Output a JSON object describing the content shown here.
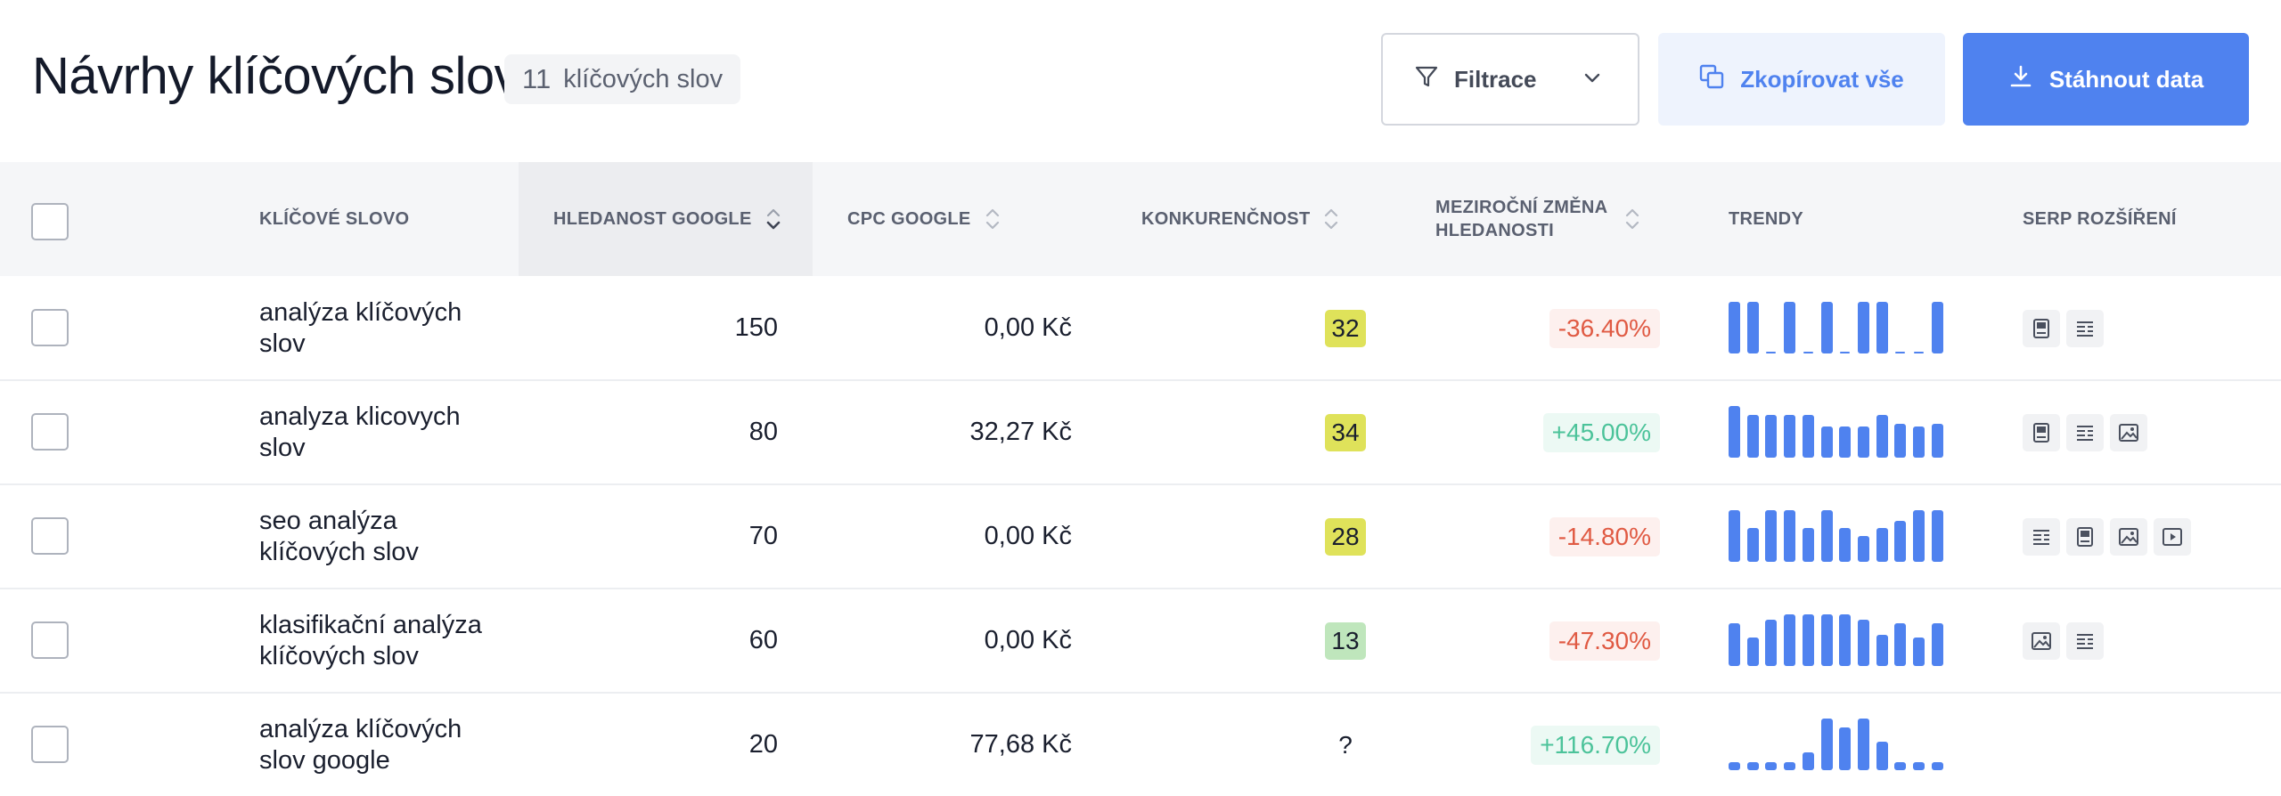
{
  "header": {
    "title": "Návrhy klíčových slov",
    "count": "11",
    "count_label": "klíčových slov",
    "filter_label": "Filtrace",
    "copy_label": "Zkopírovat vše",
    "download_label": "Stáhnout data"
  },
  "table": {
    "columns": {
      "keyword": "KLÍČOVÉ SLOVO",
      "volume": "HLEDANOST GOOGLE",
      "cpc": "CPC GOOGLE",
      "competition": "KONKURENČNOST",
      "change_line1": "MEZIROČNÍ ZMĚNA",
      "change_line2": "HLEDANOSTI",
      "trends": "TRENDY",
      "serp": "SERP ROZŠÍŘENÍ"
    },
    "rows": [
      {
        "keyword_line1": "analýza klíčových",
        "keyword_line2": "slov",
        "volume": "150",
        "cpc": "0,00 Kč",
        "competition": "32",
        "competition_color": "#dfe25a",
        "change": "-36.40%",
        "change_type": "neg",
        "trend": [
          1,
          1,
          0,
          1,
          0,
          1,
          0,
          1,
          1,
          0,
          0,
          1
        ],
        "serp": [
          "book-icon",
          "list-icon"
        ]
      },
      {
        "keyword_line1": "analyza klicovych",
        "keyword_line2": "slov",
        "volume": "80",
        "cpc": "32,27 Kč",
        "competition": "34",
        "competition_color": "#dfe25a",
        "change": "+45.00%",
        "change_type": "pos",
        "trend": [
          1,
          0.82,
          0.82,
          0.82,
          0.82,
          0.6,
          0.6,
          0.6,
          0.82,
          0.66,
          0.6,
          0.66
        ],
        "serp": [
          "book-icon",
          "list-icon",
          "image-icon"
        ]
      },
      {
        "keyword_line1": "seo analýza",
        "keyword_line2": "klíčových slov",
        "volume": "70",
        "cpc": "0,00 Kč",
        "competition": "28",
        "competition_color": "#dfe25a",
        "change": "-14.80%",
        "change_type": "neg",
        "trend": [
          1,
          0.66,
          1,
          1,
          0.66,
          1,
          0.66,
          0.5,
          0.66,
          0.8,
          1,
          1
        ],
        "serp": [
          "list-icon",
          "book-icon",
          "image-icon",
          "video-icon"
        ]
      },
      {
        "keyword_line1": "klasifikační analýza",
        "keyword_line2": "klíčových slov",
        "volume": "60",
        "cpc": "0,00 Kč",
        "competition": "13",
        "competition_color": "#bfe6bc",
        "change": "-47.30%",
        "change_type": "neg",
        "trend": [
          0.82,
          0.55,
          0.9,
          1,
          1,
          1,
          1,
          0.9,
          0.6,
          0.82,
          0.55,
          0.82
        ],
        "serp": [
          "image-icon",
          "list-icon"
        ]
      },
      {
        "keyword_line1": "analýza klíčových",
        "keyword_line2": "slov google",
        "volume": "20",
        "cpc": "77,68 Kč",
        "competition": "?",
        "competition_color": "transparent",
        "change": "+116.70%",
        "change_type": "pos",
        "trend": [
          0.16,
          0.16,
          0.16,
          0.16,
          0.35,
          1,
          0.82,
          1,
          0.55,
          0.16,
          0.16,
          0.16
        ],
        "serp": []
      }
    ]
  },
  "colors": {
    "accent": "#4f82ef",
    "negative": "#e05a43",
    "positive": "#4cc39a"
  }
}
